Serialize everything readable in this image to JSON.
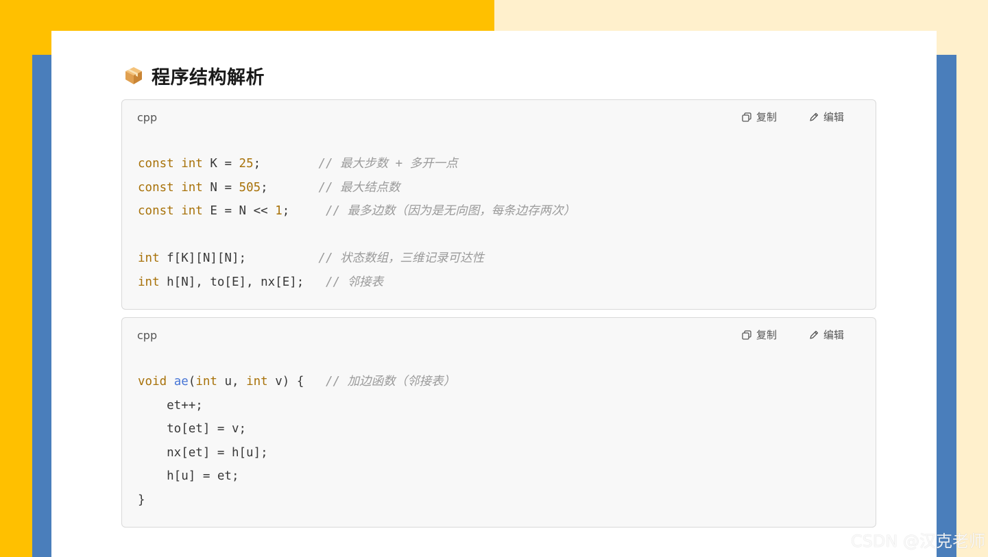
{
  "heading": {
    "icon": "package-box-icon",
    "title": "程序结构解析"
  },
  "blocks": [
    {
      "language": "cpp",
      "copy_label": "复制",
      "edit_label": "编辑",
      "lines": [
        [
          {
            "t": "const",
            "c": "kw"
          },
          {
            "t": " "
          },
          {
            "t": "int",
            "c": "kw"
          },
          {
            "t": " K = "
          },
          {
            "t": "25",
            "c": "num"
          },
          {
            "t": ";        "
          },
          {
            "t": "// 最大步数 + 多开一点",
            "c": "cm"
          }
        ],
        [
          {
            "t": "const",
            "c": "kw"
          },
          {
            "t": " "
          },
          {
            "t": "int",
            "c": "kw"
          },
          {
            "t": " N = "
          },
          {
            "t": "505",
            "c": "num"
          },
          {
            "t": ";       "
          },
          {
            "t": "// 最大结点数",
            "c": "cm"
          }
        ],
        [
          {
            "t": "const",
            "c": "kw"
          },
          {
            "t": " "
          },
          {
            "t": "int",
            "c": "kw"
          },
          {
            "t": " E = N << "
          },
          {
            "t": "1",
            "c": "num"
          },
          {
            "t": ";     "
          },
          {
            "t": "// 最多边数（因为是无向图，每条边存两次）",
            "c": "cm"
          }
        ],
        [],
        [
          {
            "t": "int",
            "c": "kw"
          },
          {
            "t": " f[K][N][N];          "
          },
          {
            "t": "// 状态数组，三维记录可达性",
            "c": "cm"
          }
        ],
        [
          {
            "t": "int",
            "c": "kw"
          },
          {
            "t": " h[N], to[E], nx[E];   "
          },
          {
            "t": "// 邻接表",
            "c": "cm"
          }
        ]
      ]
    },
    {
      "language": "cpp",
      "copy_label": "复制",
      "edit_label": "编辑",
      "lines": [
        [
          {
            "t": "void",
            "c": "kw"
          },
          {
            "t": " "
          },
          {
            "t": "ae",
            "c": "fn"
          },
          {
            "t": "("
          },
          {
            "t": "int",
            "c": "kw"
          },
          {
            "t": " u, "
          },
          {
            "t": "int",
            "c": "kw"
          },
          {
            "t": " v) {   "
          },
          {
            "t": "// 加边函数（邻接表）",
            "c": "cm"
          }
        ],
        [
          {
            "t": "    et++;"
          }
        ],
        [
          {
            "t": "    to[et] = v;"
          }
        ],
        [
          {
            "t": "    nx[et] = h[u];"
          }
        ],
        [
          {
            "t": "    h[u] = et;"
          }
        ],
        [
          {
            "t": "}"
          }
        ]
      ]
    }
  ],
  "watermark": "CSDN @汉克老师",
  "colors": {
    "left_background": "#FFC000",
    "right_background": "#FFF0CC",
    "side_bars": "#4A7EBB",
    "keyword": "#A8720A",
    "function": "#4876D6",
    "comment": "#9A9A9A"
  }
}
